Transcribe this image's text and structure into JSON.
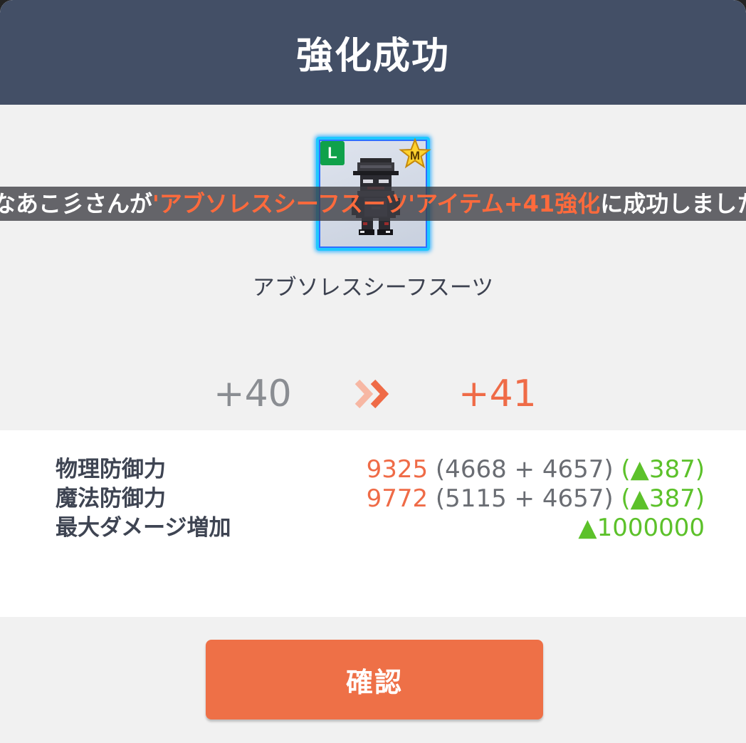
{
  "dialog": {
    "title": "強化成功"
  },
  "item": {
    "grade_badge": "L",
    "star_badge": "M",
    "icon": "thief-suit-figure-icon",
    "name": "アブソレスシーフスーツ"
  },
  "announcement": {
    "prefix": "なあこ彡さんが",
    "highlight": "'アブソレスシーフスーツ'アイテム+41強化",
    "suffix": "に成功しました"
  },
  "level": {
    "from": "+40",
    "to": "+41",
    "arrow_icon": "double-chevron-right-icon"
  },
  "stats": [
    {
      "label": "物理防御力",
      "total": "9325",
      "detail": " (4668 + 4657) ",
      "gain": "(▲387)"
    },
    {
      "label": "魔法防御力",
      "total": "9772",
      "detail": " (5115 + 4657) ",
      "gain": "(▲387)"
    },
    {
      "label": "最大ダメージ増加",
      "total": "",
      "detail": "",
      "gain": "▲1000000"
    }
  ],
  "confirm_button": {
    "label": "確認"
  },
  "colors": {
    "header_bg": "#434f66",
    "accent_orange": "#ef6b47",
    "gain_green": "#5cc12a",
    "item_border": "#1ec8ff",
    "grade_badge_green": "#0fa14a"
  }
}
